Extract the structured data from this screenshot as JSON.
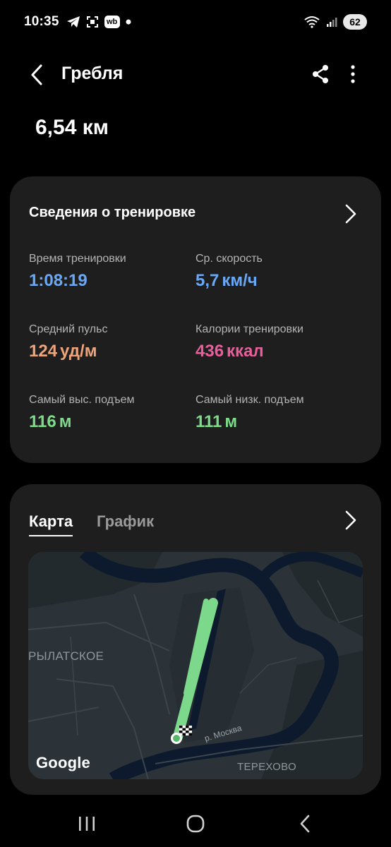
{
  "status_bar": {
    "time": "10:35",
    "battery": "62",
    "icons": [
      "telegram-icon",
      "screenshot-icon",
      "wb-icon",
      "dot-icon",
      "wifi-icon",
      "signal-icon"
    ],
    "wb_label": "wb"
  },
  "header": {
    "title": "Гребля",
    "distance": "6,54 км"
  },
  "details": {
    "title": "Сведения о тренировке",
    "stats": [
      {
        "label": "Время тренировки",
        "value": "1:08:19",
        "unit": "",
        "color": "#6aa8f5"
      },
      {
        "label": "Ср. скорость",
        "value": "5,7",
        "unit": "км/ч",
        "color": "#6aa8f5"
      },
      {
        "label": "Средний пульс",
        "value": "124",
        "unit": "уд/м",
        "color": "#eea47a"
      },
      {
        "label": "Калории тренировки",
        "value": "436",
        "unit": "ккал",
        "color": "#ea5f9b"
      },
      {
        "label": "Самый выс. подъем",
        "value": "116",
        "unit": "м",
        "color": "#7edb8c"
      },
      {
        "label": "Самый низк. подъем",
        "value": "111",
        "unit": "м",
        "color": "#7edb8c"
      }
    ]
  },
  "map_card": {
    "tabs": [
      "Карта",
      "График"
    ],
    "active_tab": "Карта",
    "labels": {
      "district": "РЫЛАТСКОЕ",
      "river": "р. Москва",
      "district2": "ТЕРЕХОВО",
      "attribution": "Google"
    },
    "route_color": "#7cd98b"
  }
}
